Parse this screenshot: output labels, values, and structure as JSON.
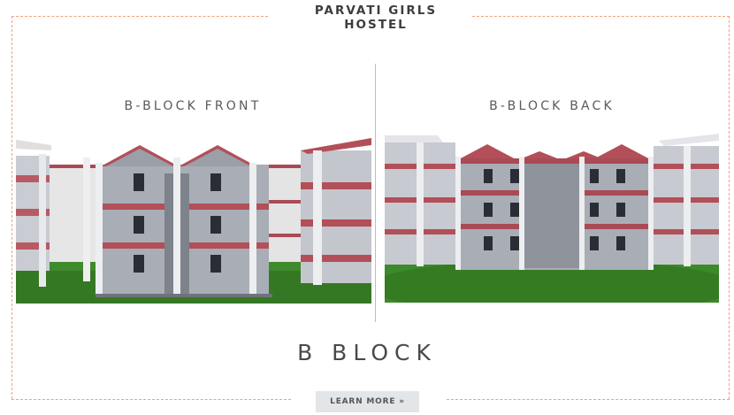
{
  "header": {
    "title_line1": "PARVATI GIRLS",
    "title_line2": "HOSTEL"
  },
  "views": {
    "front_label": "B-BLOCK FRONT",
    "back_label": "B-BLOCK BACK"
  },
  "main": {
    "block_title": "B BLOCK"
  },
  "cta": {
    "learn_more_label": "LEARN MORE »"
  },
  "colors": {
    "frame_dash": "#f2a07b",
    "roof_red": "#a94a55",
    "wall_grey": "#a9adb6",
    "lawn_green": "#3f8a2c",
    "button_bg": "#e3e6e8"
  }
}
